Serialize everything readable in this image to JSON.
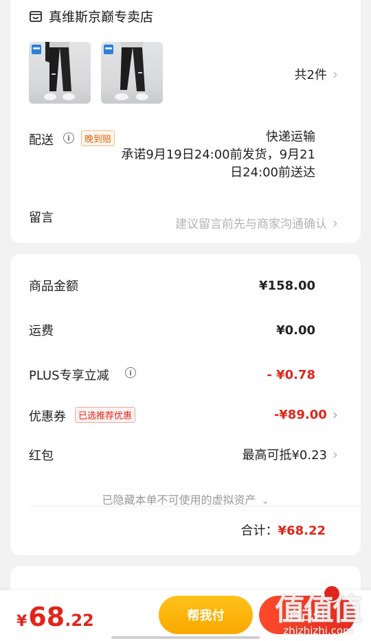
{
  "store": {
    "name": "真维斯京巅专卖店",
    "icon": "store-icon",
    "item_count": "共2件",
    "products": [
      {
        "image": "black-jogger-pants",
        "tag": "promo-badge"
      },
      {
        "image": "black-jogger-pants",
        "tag": "promo-badge"
      }
    ]
  },
  "delivery": {
    "label": "配送",
    "tag": "晚到赔",
    "method": "快递运输",
    "promise_line1": "承诺9月19日24:00前发货，9月21",
    "promise_line2": "日24:00前送达"
  },
  "message": {
    "label": "留言",
    "placeholder": "建议留言前先与商家沟通确认"
  },
  "pricing": {
    "goods_label": "商品金额",
    "goods_value": "¥158.00",
    "shipping_label": "运费",
    "shipping_value": "¥0.00",
    "plus_label": "PLUS专享立减",
    "plus_value": "- ¥0.78",
    "coupon_label": "优惠券",
    "coupon_tag": "已选推荐优惠",
    "coupon_value": "-¥89.00",
    "redpacket_label": "红包",
    "redpacket_value": "最高可抵¥0.23",
    "hidden_note": "已隐藏本单不可使用的虚拟资产",
    "total_label": "合计：",
    "total_value": "¥68.22"
  },
  "footer": {
    "pay_symbol": "¥",
    "pay_int": "68",
    "pay_dec": ".22",
    "help_pay": "帮我付",
    "self_pay": "自己付"
  },
  "watermark": {
    "big": "值值值",
    "small": "zhizhizhi.com"
  },
  "colors": {
    "accent_red": "#e1251b",
    "accent_yellow": "#f8a800",
    "tag_orange": "#e8650f"
  }
}
